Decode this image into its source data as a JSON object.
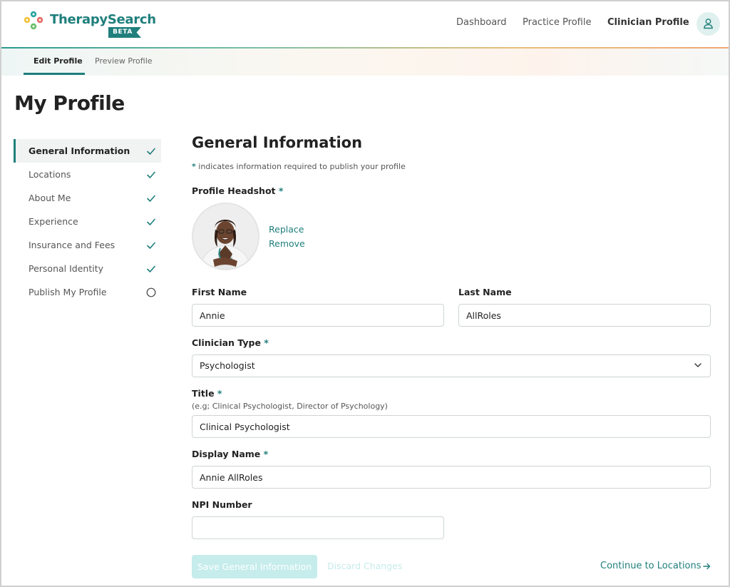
{
  "brand": {
    "name": "TherapySearch",
    "badge": "BETA",
    "accent": "#1f7f7c"
  },
  "nav": {
    "items": [
      {
        "label": "Dashboard"
      },
      {
        "label": "Practice Profile"
      },
      {
        "label": "Clinician Profile"
      }
    ],
    "active": "Clinician Profile",
    "account_icon": "user-icon"
  },
  "subtabs": {
    "items": [
      {
        "label": "Edit Profile"
      },
      {
        "label": "Preview Profile"
      }
    ],
    "active": "Edit Profile"
  },
  "page": {
    "title": "My Profile"
  },
  "sidebar": {
    "items": [
      {
        "label": "General Information",
        "status": "complete",
        "icon": "check-icon"
      },
      {
        "label": "Locations",
        "status": "complete",
        "icon": "check-icon"
      },
      {
        "label": "About Me",
        "status": "complete",
        "icon": "check-icon"
      },
      {
        "label": "Experience",
        "status": "complete",
        "icon": "check-icon"
      },
      {
        "label": "Insurance and Fees",
        "status": "complete",
        "icon": "check-icon"
      },
      {
        "label": "Personal Identity",
        "status": "complete",
        "icon": "check-icon"
      },
      {
        "label": "Publish My Profile",
        "status": "incomplete",
        "icon": "empty-circle-icon"
      }
    ],
    "active": "General Information"
  },
  "form": {
    "title": "General Information",
    "required_mark": "*",
    "required_note": "indicates information required to publish your profile",
    "headshot": {
      "label": "Profile Headshot",
      "replace_label": "Replace",
      "remove_label": "Remove"
    },
    "first_name": {
      "label": "First Name",
      "value": "Annie"
    },
    "last_name": {
      "label": "Last Name",
      "value": "AllRoles"
    },
    "clinician_type": {
      "label": "Clinician Type",
      "value": "Psychologist"
    },
    "title_field": {
      "label": "Title",
      "hint": "(e.g; Clinical Psychologist, Director of Psychology)",
      "value": "Clinical Psychologist"
    },
    "display_name": {
      "label": "Display Name",
      "value": "Annie AllRoles"
    },
    "npi": {
      "label": "NPI Number",
      "value": ""
    }
  },
  "actions": {
    "save_label": "Save General Information",
    "discard_label": "Discard Changes",
    "continue_label": "Continue to Locations"
  }
}
